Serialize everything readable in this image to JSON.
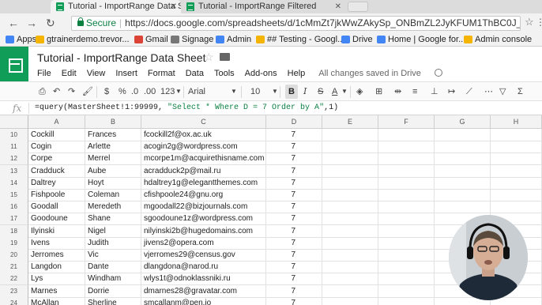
{
  "browser": {
    "tabs": [
      {
        "title": "Tutorial - ImportRange Data S",
        "active": true
      },
      {
        "title": "Tutorial - ImportRange Filtered",
        "active": false
      }
    ],
    "secure_label": "Secure",
    "url": "https://docs.google.com/spreadsheets/d/1cMmZt7jkWwZAkySp_ONBmZL2JyKFUM1ThBC0J_a-pA/edi",
    "bookmarks": [
      {
        "label": "Apps",
        "icon": "apps-grid-icon",
        "color": "#4285f4"
      },
      {
        "label": "gtrainerdemo.trevor...",
        "icon": "google-account-icon",
        "color": "#f4b400"
      },
      {
        "label": "Gmail",
        "icon": "gmail-icon",
        "color": "#db4437"
      },
      {
        "label": "Signage",
        "icon": "folder-icon",
        "color": "#777777"
      },
      {
        "label": "Admin",
        "icon": "admin-icon",
        "color": "#4285f4"
      },
      {
        "label": "## Testing - Googl...",
        "icon": "drive-icon",
        "color": "#f4b400"
      },
      {
        "label": "Drive",
        "icon": "google-icon",
        "color": "#4285f4"
      },
      {
        "label": "Home | Google for...",
        "icon": "google-icon",
        "color": "#4285f4"
      },
      {
        "label": "Admin console",
        "icon": "admin-icon",
        "color": "#f4b400"
      }
    ]
  },
  "sheet": {
    "title": "Tutorial - ImportRange Data Sheet",
    "menu": [
      "File",
      "Edit",
      "View",
      "Insert",
      "Format",
      "Data",
      "Tools",
      "Add-ons",
      "Help"
    ],
    "save_status": "All changes saved in Drive",
    "toolbar": {
      "zoom": "100%",
      "currency": "$",
      "percent": "%",
      "decimal_less": ".0",
      "decimal_more": ".00",
      "format_more": "123",
      "font": "Arial",
      "font_size": "10",
      "bold": "B",
      "italic": "I",
      "strike": "S",
      "text_color": "A"
    },
    "formula": {
      "fx_label": "fx",
      "code_prefix": "=query(MasterSheet!1:99999, ",
      "code_string": "\"Select * Where D = 7 Order by A\"",
      "code_suffix": ",1)"
    },
    "columns": [
      "A",
      "B",
      "C",
      "D",
      "E",
      "F",
      "G",
      "H"
    ],
    "rows": [
      {
        "n": "10",
        "a": "Cockill",
        "b": "Frances",
        "c": "fcockill2f@ox.ac.uk",
        "d": "7"
      },
      {
        "n": "11",
        "a": "Cogin",
        "b": "Arlette",
        "c": "acogin2g@wordpress.com",
        "d": "7"
      },
      {
        "n": "12",
        "a": "Corpe",
        "b": "Merrel",
        "c": "mcorpe1m@acquirethisname.com",
        "d": "7"
      },
      {
        "n": "13",
        "a": "Cradduck",
        "b": "Aube",
        "c": "acradduck2p@mail.ru",
        "d": "7"
      },
      {
        "n": "14",
        "a": "Daltrey",
        "b": "Hoyt",
        "c": "hdaltrey1g@elegantthemes.com",
        "d": "7"
      },
      {
        "n": "15",
        "a": "Fishpoole",
        "b": "Coleman",
        "c": "cfishpoole24@gnu.org",
        "d": "7"
      },
      {
        "n": "16",
        "a": "Goodall",
        "b": "Meredeth",
        "c": "mgoodall22@bizjournals.com",
        "d": "7"
      },
      {
        "n": "17",
        "a": "Goodoune",
        "b": "Shane",
        "c": "sgoodoune1z@wordpress.com",
        "d": "7"
      },
      {
        "n": "18",
        "a": "Ilyinski",
        "b": "Nigel",
        "c": "nilyinski2b@hugedomains.com",
        "d": "7"
      },
      {
        "n": "19",
        "a": "Ivens",
        "b": "Judith",
        "c": "jivens2@opera.com",
        "d": "7"
      },
      {
        "n": "20",
        "a": "Jerromes",
        "b": "Vic",
        "c": "vjerromes29@census.gov",
        "d": "7"
      },
      {
        "n": "21",
        "a": "Langdon",
        "b": "Dante",
        "c": "dlangdona@narod.ru",
        "d": "7"
      },
      {
        "n": "22",
        "a": "Lys",
        "b": "Windham",
        "c": "wlys1t@odnoklassniki.ru",
        "d": "7"
      },
      {
        "n": "23",
        "a": "Marnes",
        "b": "Dorrie",
        "c": "dmarnes28@gravatar.com",
        "d": "7"
      },
      {
        "n": "24",
        "a": "McAllan",
        "b": "Sherline",
        "c": "smcallanm@pen.io",
        "d": "7"
      }
    ]
  }
}
